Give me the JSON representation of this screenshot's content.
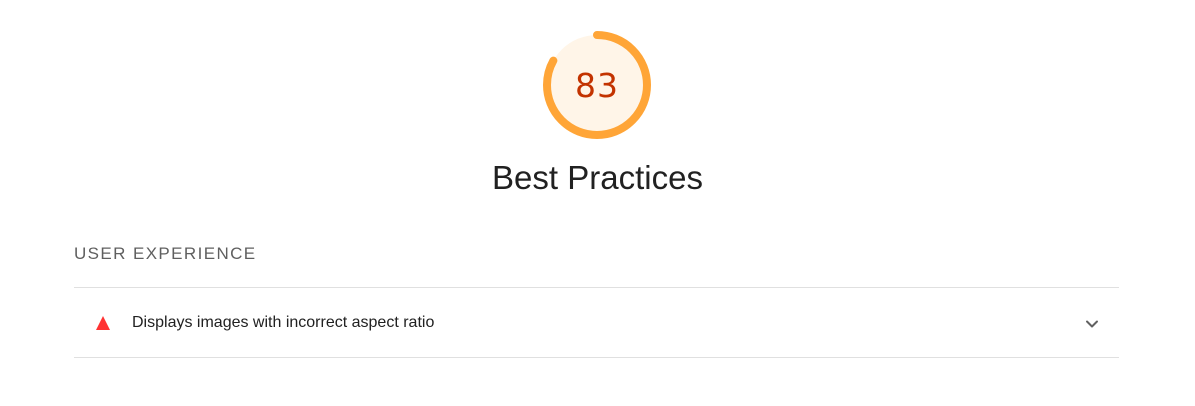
{
  "gauge": {
    "score": "83",
    "score_fraction": 0.83,
    "colors": {
      "arc": "#ffa537",
      "fill": "#fff5e8",
      "text": "#c33300"
    }
  },
  "category": {
    "title": "Best Practices"
  },
  "section": {
    "heading": "USER EXPERIENCE",
    "audits": [
      {
        "title": "Displays images with incorrect aspect ratio",
        "status_icon": "fail-triangle-icon",
        "status_color": "#ff3333",
        "expand_icon": "chevron-down-icon"
      }
    ]
  }
}
